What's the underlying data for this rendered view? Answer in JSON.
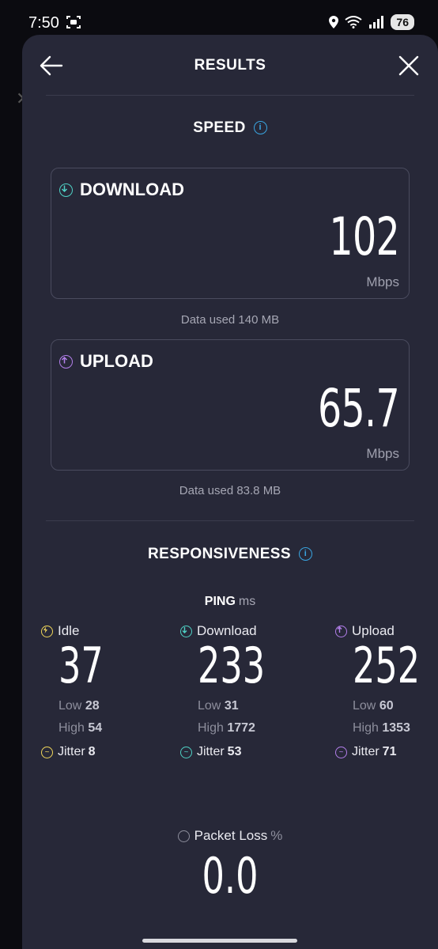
{
  "status_bar": {
    "time": "7:50",
    "battery": "76"
  },
  "header": {
    "title": "RESULTS"
  },
  "speed": {
    "title": "SPEED",
    "download": {
      "label": "DOWNLOAD",
      "value": "102",
      "unit": "Mbps",
      "data_used": "Data used 140 MB"
    },
    "upload": {
      "label": "UPLOAD",
      "value": "65.7",
      "unit": "Mbps",
      "data_used": "Data used 83.8 MB"
    }
  },
  "responsiveness": {
    "title": "RESPONSIVENESS",
    "ping_label": "PING",
    "ping_unit": "ms",
    "columns": [
      {
        "label": "Idle",
        "value": "37",
        "low_label": "Low",
        "low": "28",
        "high_label": "High",
        "high": "54",
        "jitter_label": "Jitter",
        "jitter": "8"
      },
      {
        "label": "Download",
        "value": "233",
        "low_label": "Low",
        "low": "31",
        "high_label": "High",
        "high": "1772",
        "jitter_label": "Jitter",
        "jitter": "53"
      },
      {
        "label": "Upload",
        "value": "252",
        "low_label": "Low",
        "low": "60",
        "high_label": "High",
        "high": "1353",
        "jitter_label": "Jitter",
        "jitter": "71"
      }
    ]
  },
  "packet_loss": {
    "label": "Packet Loss",
    "unit": "%",
    "value": "0.0"
  },
  "colors": {
    "download": "#4fd1c5",
    "upload": "#b37feb",
    "idle": "#f1d75a",
    "info": "#39a4e0",
    "panel": "#272838"
  }
}
